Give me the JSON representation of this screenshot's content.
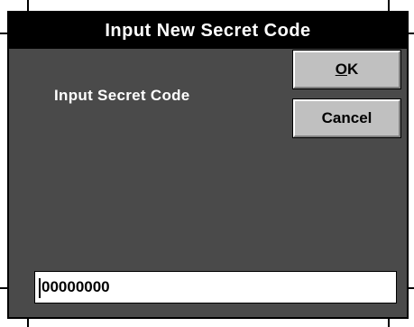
{
  "dialog": {
    "title": "Input New Secret Code",
    "prompt_label": "Input Secret Code",
    "code_value": "00000000"
  },
  "buttons": {
    "ok_mnemonic": "O",
    "ok_rest": "K",
    "cancel_label": "Cancel"
  },
  "colors": {
    "titlebar_bg": "#000000",
    "dialog_bg": "#4a4a4a",
    "button_face": "#c0c0c0",
    "input_bg": "#ffffff"
  }
}
